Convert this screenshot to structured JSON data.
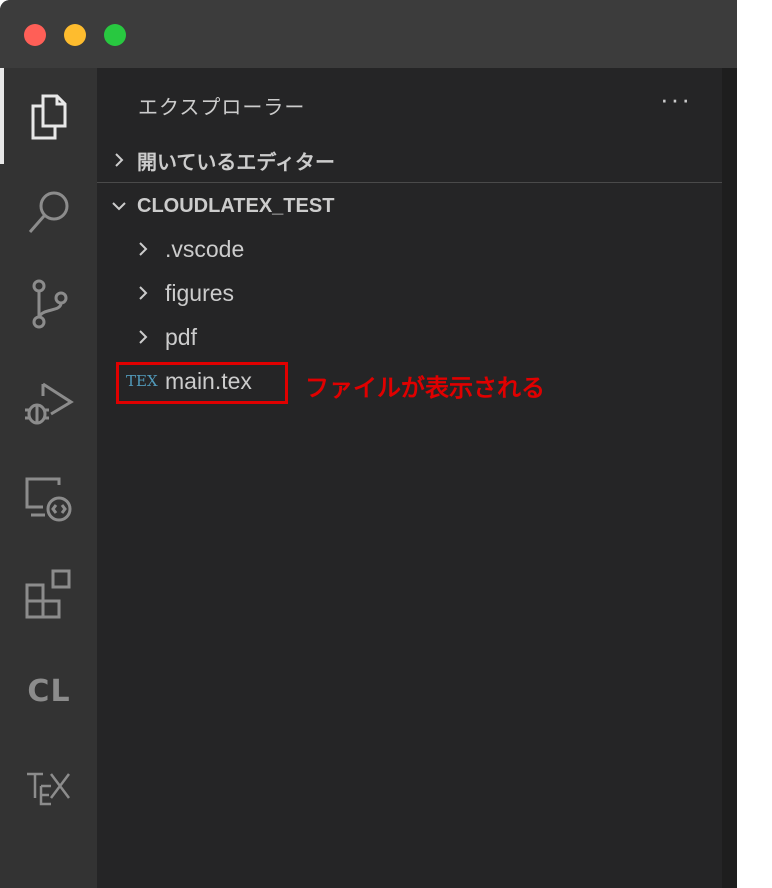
{
  "window": {
    "traffic_lights": [
      {
        "name": "close",
        "color": "#ff5f57"
      },
      {
        "name": "minimize",
        "color": "#febc2e"
      },
      {
        "name": "zoom",
        "color": "#28c840"
      }
    ]
  },
  "activity_bar": {
    "items": [
      {
        "id": "explorer",
        "icon": "files-icon",
        "active": true
      },
      {
        "id": "search",
        "icon": "search-icon"
      },
      {
        "id": "source-control",
        "icon": "source-control-icon"
      },
      {
        "id": "run-debug",
        "icon": "run-debug-icon"
      },
      {
        "id": "remote-explorer",
        "icon": "remote-explorer-icon"
      },
      {
        "id": "extensions",
        "icon": "extensions-icon"
      },
      {
        "id": "cloudlatex",
        "icon": "cloudlatex-icon",
        "text": "CL"
      },
      {
        "id": "tex",
        "icon": "tex-icon"
      }
    ]
  },
  "sidebar": {
    "title": "エクスプローラー",
    "more_actions": "···",
    "sections": [
      {
        "label": "開いているエディター",
        "expanded": false
      },
      {
        "label": "CLOUDLATEX_TEST",
        "expanded": true
      }
    ],
    "tree": [
      {
        "label": ".vscode",
        "type": "folder"
      },
      {
        "label": "figures",
        "type": "folder"
      },
      {
        "label": "pdf",
        "type": "folder"
      },
      {
        "label": "main.tex",
        "type": "file",
        "icon_text": "TEX"
      }
    ]
  },
  "annotation": {
    "text": "ファイルが表示される",
    "color": "#e00000"
  },
  "colors": {
    "titlebar": "#3c3c3c",
    "activity_bar": "#333333",
    "sidebar": "#252526",
    "foreground": "#cccccc",
    "tex_icon": "#519aba"
  }
}
